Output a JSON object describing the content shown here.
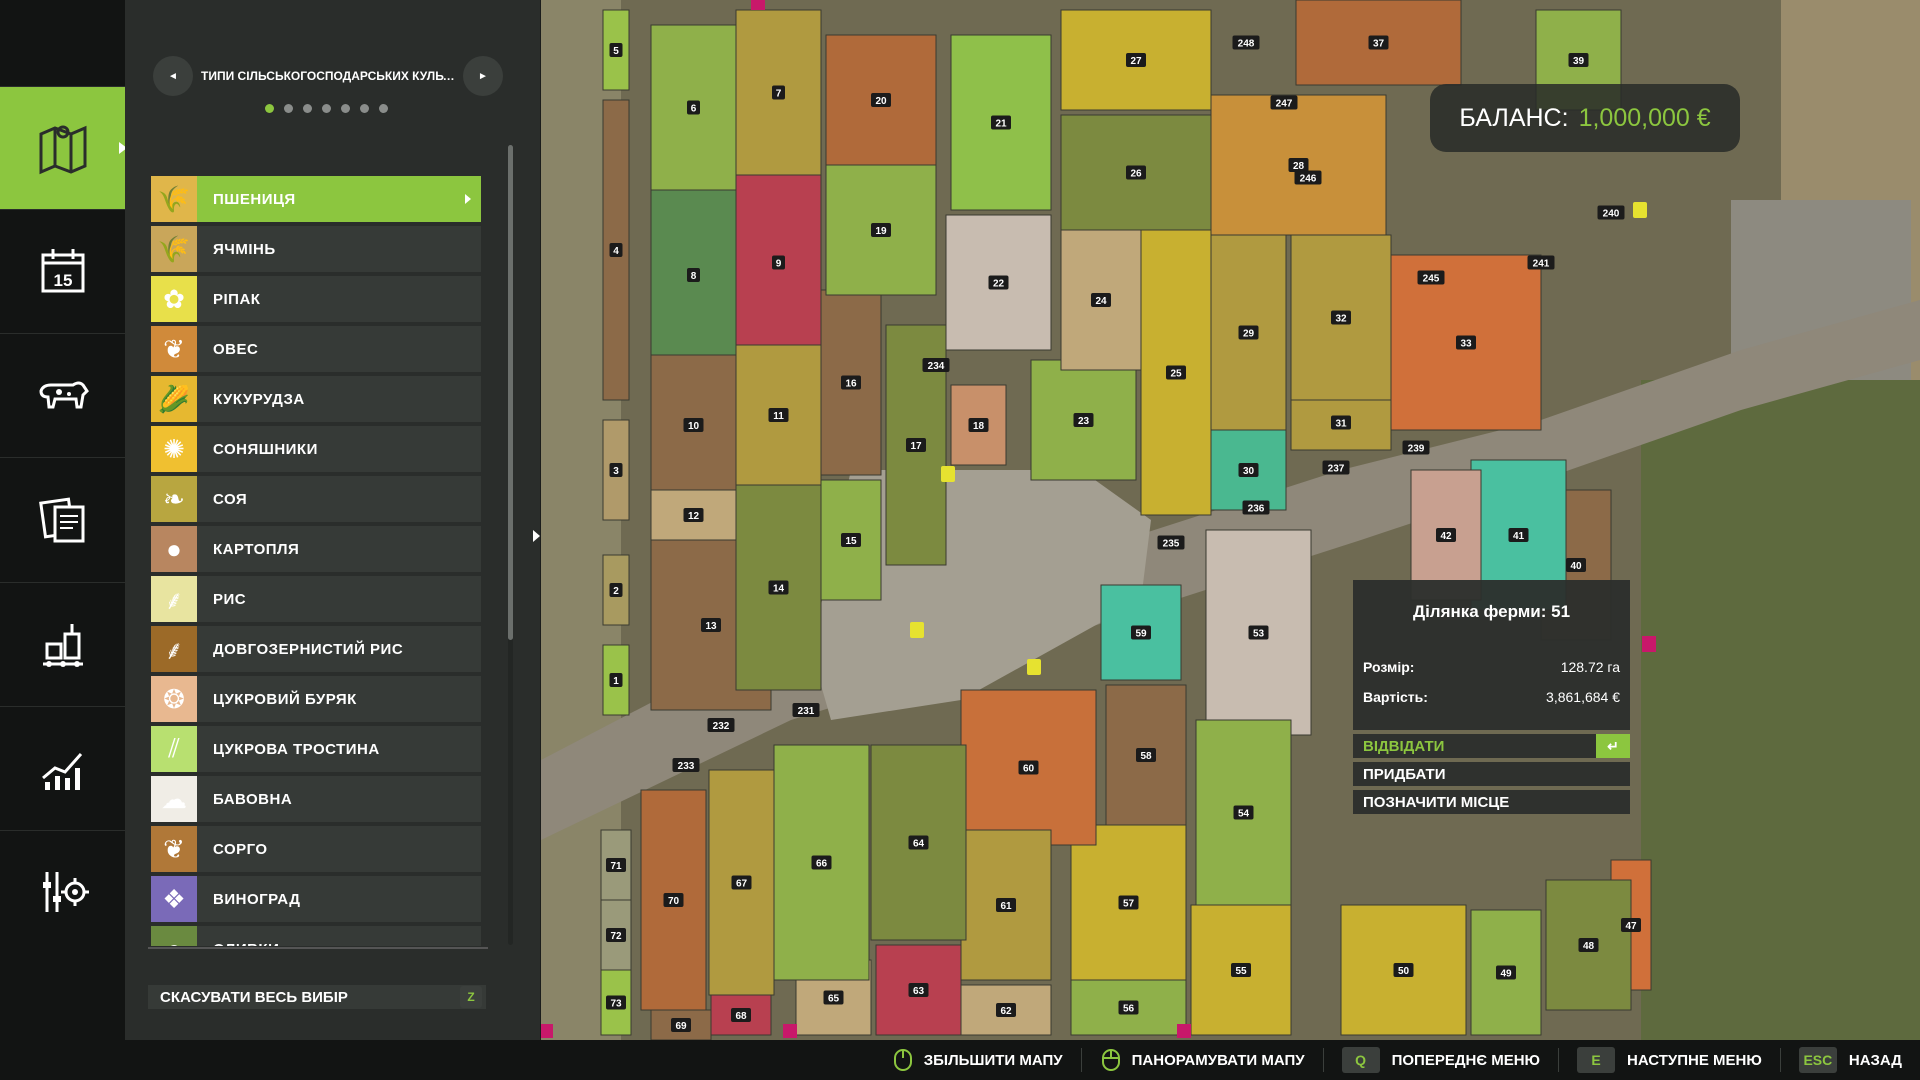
{
  "rail": {
    "items": [
      {
        "name": "map-icon",
        "active": true
      },
      {
        "name": "calendar-icon",
        "active": false,
        "text": "15"
      },
      {
        "name": "animals-icon",
        "active": false
      },
      {
        "name": "contracts-icon",
        "active": false
      },
      {
        "name": "production-icon",
        "active": false
      },
      {
        "name": "statistics-icon",
        "active": false
      },
      {
        "name": "settings-icon",
        "active": false
      }
    ]
  },
  "panel": {
    "pager_title": "ТИПИ СІЛЬСЬКОГОСПОДАРСЬКИХ КУЛЬТУ...",
    "prev_glyph": "◄",
    "next_glyph": "►",
    "page_count": 7,
    "active_page": 0,
    "crops": [
      {
        "label": "ПШЕНИЦЯ",
        "icon": "wheat-icon",
        "color": "#e0b64a",
        "glyph": "🌾",
        "selected": true
      },
      {
        "label": "ЯЧМІНЬ",
        "icon": "barley-icon",
        "color": "#c9a65a",
        "glyph": "🌾",
        "selected": false
      },
      {
        "label": "РІПАК",
        "icon": "canola-icon",
        "color": "#e8e04a",
        "glyph": "✿",
        "selected": false
      },
      {
        "label": "ОВЕС",
        "icon": "oat-icon",
        "color": "#d08a3a",
        "glyph": "❦",
        "selected": false
      },
      {
        "label": "КУКУРУДЗА",
        "icon": "corn-icon",
        "color": "#e6b830",
        "glyph": "🌽",
        "selected": false
      },
      {
        "label": "СОНЯШНИКИ",
        "icon": "sunflower-icon",
        "color": "#f0c030",
        "glyph": "✺",
        "selected": false
      },
      {
        "label": "СОЯ",
        "icon": "soybean-icon",
        "color": "#b8a640",
        "glyph": "❧",
        "selected": false
      },
      {
        "label": "КАРТОПЛЯ",
        "icon": "potato-icon",
        "color": "#b88660",
        "glyph": "●",
        "selected": false
      },
      {
        "label": "РИС",
        "icon": "rice-icon",
        "color": "#e8e4a0",
        "glyph": "⸙",
        "selected": false
      },
      {
        "label": "ДОВГОЗЕРНИСТИЙ РИС",
        "icon": "long-grain-rice-icon",
        "color": "#9c6a28",
        "glyph": "⸙",
        "selected": false
      },
      {
        "label": "ЦУКРОВИЙ БУРЯК",
        "icon": "sugar-beet-icon",
        "color": "#e8b890",
        "glyph": "❂",
        "selected": false
      },
      {
        "label": "ЦУКРОВА ТРОСТИНА",
        "icon": "sugarcane-icon",
        "color": "#b8e070",
        "glyph": "⫽",
        "selected": false
      },
      {
        "label": "БАВОВНА",
        "icon": "cotton-icon",
        "color": "#f0ede6",
        "glyph": "☁",
        "selected": false
      },
      {
        "label": "СОРГО",
        "icon": "sorghum-icon",
        "color": "#b07838",
        "glyph": "❦",
        "selected": false
      },
      {
        "label": "ВИНОГРАД",
        "icon": "grapes-icon",
        "color": "#7a6ab8",
        "glyph": "❖",
        "selected": false
      },
      {
        "label": "ОЛИВКИ",
        "icon": "olives-icon",
        "color": "#6a8a40",
        "glyph": "●",
        "selected": false
      }
    ],
    "clear_label": "СКАСУВАТИ ВЕСЬ ВИБІР",
    "clear_key": "Z"
  },
  "balance": {
    "label": "БАЛАНС:",
    "value": "1,000,000 €"
  },
  "popup": {
    "title": "Ділянка ферми: 51",
    "size_label": "Розмір:",
    "size_value": "128.72 га",
    "price_label": "Вартість:",
    "price_value": "3,861,684 €",
    "actions": [
      {
        "label": "ВІДВІДАТИ",
        "selected": true
      },
      {
        "label": "ПРИДБАТИ",
        "selected": false
      },
      {
        "label": "ПОЗНАЧИТИ МІСЦЕ",
        "selected": false
      }
    ]
  },
  "bottom_hints": [
    {
      "key": "",
      "icon": "mouse-icon",
      "label": "ЗБІЛЬШИТИ МАПУ"
    },
    {
      "key": "",
      "icon": "mouse-icon",
      "label": "ПАНОРАМУВАТИ МАПУ"
    },
    {
      "key": "Q",
      "icon": "",
      "label": "ПОПЕРЕДНЄ МЕНЮ"
    },
    {
      "key": "E",
      "icon": "",
      "label": "НАСТУПНЕ МЕНЮ"
    },
    {
      "key": "ESC",
      "icon": "",
      "label": "НАЗАД"
    }
  ],
  "map": {
    "fields": [
      {
        "n": "1"
      },
      {
        "n": "2"
      },
      {
        "n": "3"
      },
      {
        "n": "4"
      },
      {
        "n": "5"
      },
      {
        "n": "6"
      },
      {
        "n": "7"
      },
      {
        "n": "8"
      },
      {
        "n": "9"
      },
      {
        "n": "10"
      },
      {
        "n": "11"
      },
      {
        "n": "12"
      },
      {
        "n": "13"
      },
      {
        "n": "14"
      },
      {
        "n": "15"
      },
      {
        "n": "16"
      },
      {
        "n": "17"
      },
      {
        "n": "18"
      },
      {
        "n": "19"
      },
      {
        "n": "20"
      },
      {
        "n": "21"
      },
      {
        "n": "22"
      },
      {
        "n": "23"
      },
      {
        "n": "24"
      },
      {
        "n": "25"
      },
      {
        "n": "26"
      },
      {
        "n": "27"
      },
      {
        "n": "28"
      },
      {
        "n": "29"
      },
      {
        "n": "30"
      },
      {
        "n": "31"
      },
      {
        "n": "32"
      },
      {
        "n": "33"
      },
      {
        "n": "37"
      },
      {
        "n": "39"
      },
      {
        "n": "40"
      },
      {
        "n": "41"
      },
      {
        "n": "42"
      },
      {
        "n": "47"
      },
      {
        "n": "48"
      },
      {
        "n": "49"
      },
      {
        "n": "50"
      },
      {
        "n": "53"
      },
      {
        "n": "54"
      },
      {
        "n": "55"
      },
      {
        "n": "56"
      },
      {
        "n": "57"
      },
      {
        "n": "58"
      },
      {
        "n": "59"
      },
      {
        "n": "60"
      },
      {
        "n": "61"
      },
      {
        "n": "62"
      },
      {
        "n": "63"
      },
      {
        "n": "64"
      },
      {
        "n": "65"
      },
      {
        "n": "66"
      },
      {
        "n": "67"
      },
      {
        "n": "68"
      },
      {
        "n": "69"
      },
      {
        "n": "70"
      },
      {
        "n": "71"
      },
      {
        "n": "72"
      },
      {
        "n": "73"
      },
      {
        "n": "231"
      },
      {
        "n": "232"
      },
      {
        "n": "233"
      },
      {
        "n": "234"
      },
      {
        "n": "235"
      },
      {
        "n": "236"
      },
      {
        "n": "237"
      },
      {
        "n": "239"
      },
      {
        "n": "245"
      },
      {
        "n": "246"
      },
      {
        "n": "247"
      },
      {
        "n": "248"
      },
      {
        "n": "240"
      },
      {
        "n": "241"
      }
    ]
  }
}
